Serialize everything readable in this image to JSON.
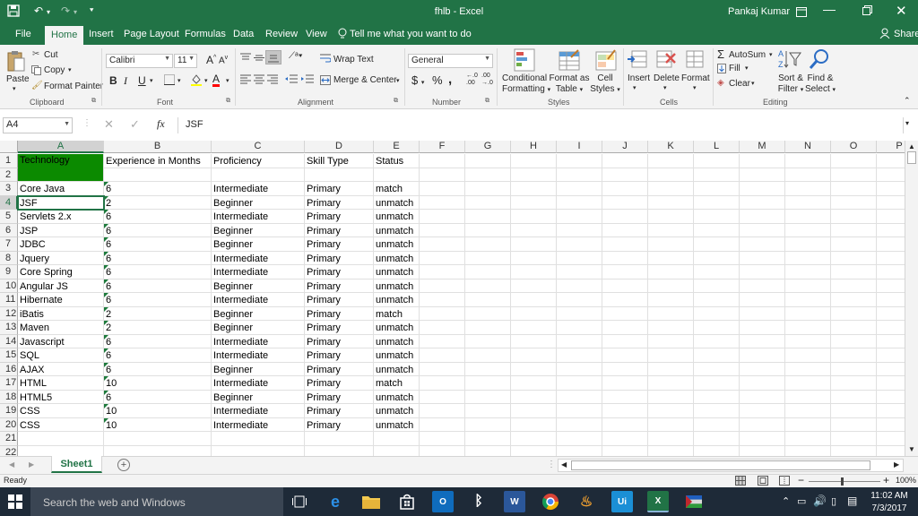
{
  "app": {
    "title": "fhlb  -  Excel",
    "user": "Pankaj Kumar",
    "share": "Share",
    "quick_access_save": "💾"
  },
  "tabs": [
    "File",
    "Home",
    "Insert",
    "Page Layout",
    "Formulas",
    "Data",
    "Review",
    "View"
  ],
  "tell_me": "Tell me what you want to do",
  "ribbon": {
    "paste": "Paste",
    "cut": "Cut",
    "copy": "Copy",
    "format_painter": "Format Painter",
    "clipboard": "Clipboard",
    "font_name": "Calibri",
    "font_size": "11",
    "font_group": "Font",
    "wrap_text": "Wrap Text",
    "merge_center": "Merge & Center",
    "alignment_group": "Alignment",
    "number_format": "General",
    "number_group": "Number",
    "conditional_formatting_1": "Conditional",
    "conditional_formatting_2": "Formatting",
    "format_as_table_1": "Format as",
    "format_as_table_2": "Table",
    "cell_styles_1": "Cell",
    "cell_styles_2": "Styles",
    "styles_group": "Styles",
    "insert": "Insert",
    "delete": "Delete",
    "format": "Format",
    "cells_group": "Cells",
    "autosum": "AutoSum",
    "fill": "Fill",
    "clear": "Clear",
    "sort_filter_1": "Sort &",
    "sort_filter_2": "Filter",
    "find_select_1": "Find &",
    "find_select_2": "Select",
    "editing_group": "Editing"
  },
  "formula_bar": {
    "name_box": "A4",
    "fx": "fx",
    "content": "JSF"
  },
  "grid": {
    "columns": [
      "A",
      "B",
      "C",
      "D",
      "E",
      "F",
      "G",
      "H",
      "I",
      "J",
      "K",
      "L",
      "M",
      "N",
      "O",
      "P"
    ],
    "row_numbers": [
      "1",
      "2",
      "3",
      "4",
      "5",
      "6",
      "7",
      "8",
      "9",
      "10",
      "11",
      "12",
      "13",
      "14",
      "15",
      "16",
      "17",
      "18",
      "19",
      "20",
      "21",
      "22"
    ],
    "header": [
      "Technology",
      "Experience in Months",
      "Proficiency",
      "Skill Type",
      "Status"
    ],
    "rows": [
      [
        "Core Java",
        "6",
        "Intermediate",
        "Primary",
        "match"
      ],
      [
        "JSF",
        "2",
        "Beginner",
        "Primary",
        "unmatch"
      ],
      [
        "Servlets 2.x",
        "6",
        "Intermediate",
        "Primary",
        "unmatch"
      ],
      [
        "JSP",
        "6",
        "Beginner",
        "Primary",
        "unmatch"
      ],
      [
        "JDBC",
        "6",
        "Beginner",
        "Primary",
        "unmatch"
      ],
      [
        "Jquery",
        "6",
        "Intermediate",
        "Primary",
        "unmatch"
      ],
      [
        "Core Spring",
        "6",
        "Intermediate",
        "Primary",
        "unmatch"
      ],
      [
        "Angular JS",
        "6",
        "Beginner",
        "Primary",
        "unmatch"
      ],
      [
        "Hibernate",
        "6",
        "Intermediate",
        "Primary",
        "unmatch"
      ],
      [
        "iBatis",
        "2",
        "Beginner",
        "Primary",
        "match"
      ],
      [
        "Maven",
        "2",
        "Beginner",
        "Primary",
        "unmatch"
      ],
      [
        "Javascript",
        "6",
        "Intermediate",
        "Primary",
        "unmatch"
      ],
      [
        "SQL",
        "6",
        "Intermediate",
        "Primary",
        "unmatch"
      ],
      [
        "AJAX",
        "6",
        "Beginner",
        "Primary",
        "unmatch"
      ],
      [
        "HTML",
        "10",
        "Intermediate",
        "Primary",
        "match"
      ],
      [
        "HTML5",
        "6",
        "Beginner",
        "Primary",
        "unmatch"
      ],
      [
        "CSS",
        "10",
        "Intermediate",
        "Primary",
        "unmatch"
      ],
      [
        "CSS",
        "10",
        "Intermediate",
        "Primary",
        "unmatch"
      ]
    ],
    "header_fill": "#0b8a00"
  },
  "sheet_tab": "Sheet1",
  "status": {
    "ready": "Ready",
    "zoom": "100%"
  },
  "taskbar": {
    "search": "Search the web and Windows",
    "time": "11:02 AM",
    "date": "7/3/2017"
  },
  "colors": {
    "excel_green": "#217346",
    "taskbar": "#1e2a38"
  }
}
